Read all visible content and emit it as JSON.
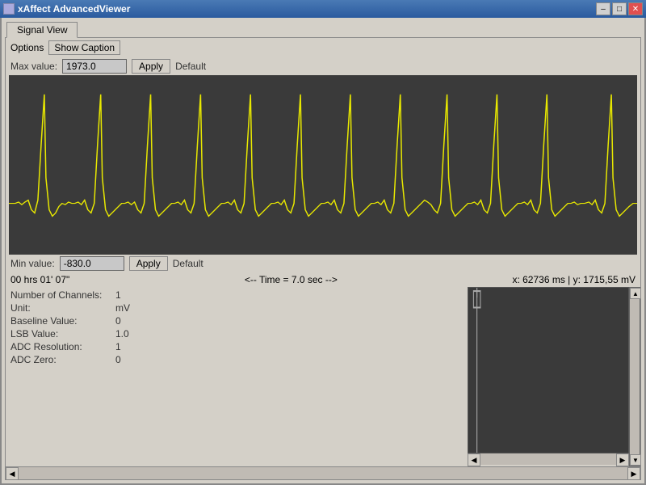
{
  "titlebar": {
    "title": "xAffect AdvancedViewer",
    "icon": "app-icon",
    "controls": {
      "minimize": "–",
      "maximize": "□",
      "close": "✕"
    }
  },
  "tabs": [
    {
      "label": "Signal View",
      "active": true
    }
  ],
  "options": {
    "label": "Options",
    "show_caption_label": "Show Caption"
  },
  "max_value": {
    "label": "Max value:",
    "value": "1973.0",
    "apply_label": "Apply",
    "default_label": "Default"
  },
  "min_value": {
    "label": "Min value:",
    "value": "-830.0",
    "apply_label": "Apply",
    "default_label": "Default"
  },
  "time_bar": {
    "time_code": "00 hrs 01' 07\"",
    "time_info": "<-- Time = 7.0 sec -->",
    "coordinates": "x: 62736 ms | y: 1715,55 mV"
  },
  "info_panel": {
    "rows": [
      {
        "key": "Number of Channels:",
        "value": "1"
      },
      {
        "key": "Unit:",
        "value": "mV"
      },
      {
        "key": "Baseline Value:",
        "value": "0"
      },
      {
        "key": "LSB Value:",
        "value": "1.0"
      },
      {
        "key": "ADC Resolution:",
        "value": "1"
      },
      {
        "key": "ADC Zero:",
        "value": "0"
      }
    ]
  },
  "chart": {
    "bg_color": "#3a3a3a",
    "signal_color": "#e8e800"
  }
}
